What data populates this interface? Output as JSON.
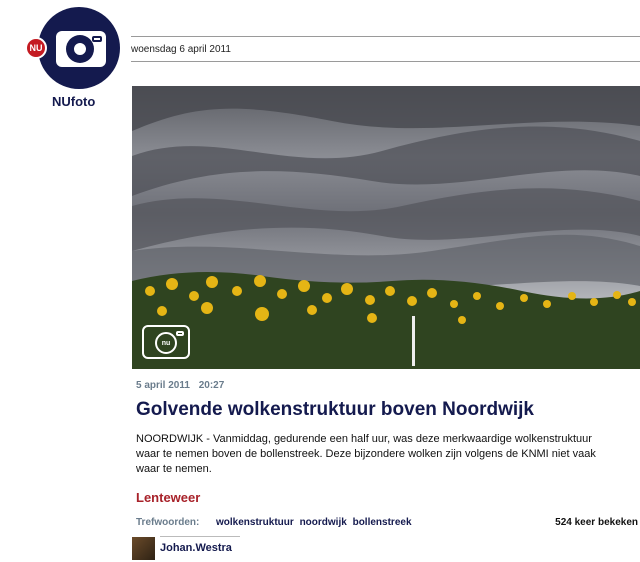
{
  "brand": {
    "name": "NUfoto",
    "badge": "NU"
  },
  "header": {
    "date": "woensdag 6 april 2011"
  },
  "photo": {
    "watermark_badge": "nu"
  },
  "article": {
    "date": "5 april 2011",
    "time": "20:27",
    "title": "Golvende wolkenstruktuur boven Noordwijk",
    "body_lines": [
      "NOORDWIJK - Vanmiddag, gedurende een half uur, was deze merkwaardige wolkenstruktuur",
      "waar te nemen boven de bollenstreek. Deze bijzondere wolken zijn volgens de KNMI niet vaak",
      "waar te nemen."
    ],
    "category": "Lenteweer",
    "tags_label": "Trefwoorden:",
    "tags": [
      "wolkenstruktuur",
      "noordwijk",
      "bollenstreek"
    ],
    "views": "524 keer bekeken",
    "author": "Johan.Westra"
  },
  "colors": {
    "navy": "#141a4e",
    "red": "#c41b22",
    "category_red": "#a8222a",
    "meta_gray": "#6a7c8c"
  }
}
